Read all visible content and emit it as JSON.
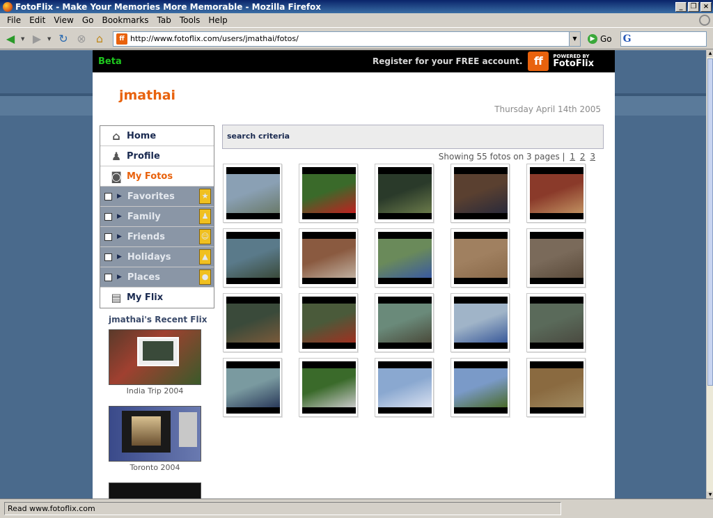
{
  "window": {
    "title": "FotoFlix - Make Your Memories More Memorable - Mozilla Firefox"
  },
  "menu": [
    "File",
    "Edit",
    "View",
    "Go",
    "Bookmarks",
    "Tab",
    "Tools",
    "Help"
  ],
  "nav": {
    "url": "http://www.fotoflix.com/users/jmathai/fotos/",
    "go_label": "Go",
    "search_logo": "G"
  },
  "banner": {
    "beta": "Beta",
    "register": "Register for your FREE account.",
    "powered_by": "POWERED BY",
    "brand": "FotoFlix",
    "logo_letters": "ff"
  },
  "profile": {
    "username": "jmathai",
    "date": "Thursday April 14th 2005"
  },
  "sidebar": {
    "items": [
      {
        "label": "Home",
        "icon": "house-icon"
      },
      {
        "label": "Profile",
        "icon": "person-icon"
      },
      {
        "label": "My Fotos",
        "icon": "camera-icon",
        "active": true
      },
      {
        "label": "Favorites",
        "icon": "star-icon",
        "folder": true
      },
      {
        "label": "Family",
        "icon": "family-icon",
        "folder": true
      },
      {
        "label": "Friends",
        "icon": "smiley-icon",
        "folder": true
      },
      {
        "label": "Holidays",
        "icon": "tree-icon",
        "folder": true
      },
      {
        "label": "Places",
        "icon": "globe-icon",
        "folder": true
      },
      {
        "label": "My Flix",
        "icon": "film-icon"
      }
    ],
    "recent_title": "jmathai's Recent Flix",
    "recent": [
      "India Trip 2004",
      "Toronto 2004"
    ]
  },
  "main": {
    "search_label": "search criteria",
    "showing_text": "Showing 55 fotos on 3 pages |",
    "pages": [
      "1",
      "2",
      "3"
    ],
    "photos": [
      {
        "name": "photo-street-scene",
        "c1": "#8aa0b4",
        "c2": "#6a7a6a"
      },
      {
        "name": "photo-red-motorcycle",
        "c1": "#3a6a2a",
        "c2": "#c02020"
      },
      {
        "name": "photo-bottle-closeup",
        "c1": "#2a3a2a",
        "c2": "#6a7a4a"
      },
      {
        "name": "photo-people-on-couch",
        "c1": "#5a4030",
        "c2": "#2a2a3a"
      },
      {
        "name": "photo-food-on-table",
        "c1": "#8a3a2a",
        "c2": "#c09060"
      },
      {
        "name": "photo-traffic-road",
        "c1": "#5a7a8a",
        "c2": "#3a4a3a"
      },
      {
        "name": "photo-two-men",
        "c1": "#8a5a40",
        "c2": "#c0b0a0"
      },
      {
        "name": "photo-women-group",
        "c1": "#6a8a5a",
        "c2": "#3a5aa0"
      },
      {
        "name": "photo-dirt-ground",
        "c1": "#a08060",
        "c2": "#8a6a4a"
      },
      {
        "name": "photo-railway-walkers",
        "c1": "#7a6a5a",
        "c2": "#5a4a3a"
      },
      {
        "name": "photo-train-station",
        "c1": "#3a4a3a",
        "c2": "#7a5a3a"
      },
      {
        "name": "photo-locomotive",
        "c1": "#4a5a3a",
        "c2": "#a03020"
      },
      {
        "name": "photo-tracks-green",
        "c1": "#6a8a7a",
        "c2": "#4a4a3a"
      },
      {
        "name": "photo-train-side",
        "c1": "#a0b4c8",
        "c2": "#3a5a9a"
      },
      {
        "name": "photo-rail-tracks",
        "c1": "#5a6a5a",
        "c2": "#4a4a40"
      },
      {
        "name": "photo-man-photographing",
        "c1": "#7a9aa0",
        "c2": "#2a3a5a"
      },
      {
        "name": "photo-bag-in-grass",
        "c1": "#3a6a2a",
        "c2": "#c8c8c8"
      },
      {
        "name": "photo-tower-sky",
        "c1": "#8aa8d0",
        "c2": "#d8e0f0"
      },
      {
        "name": "photo-lone-tree",
        "c1": "#7a9ac8",
        "c2": "#4a6a2a"
      },
      {
        "name": "photo-rocky-terrain",
        "c1": "#8a6a40",
        "c2": "#a08a60"
      }
    ]
  },
  "status": {
    "text": "Read www.fotoflix.com"
  }
}
